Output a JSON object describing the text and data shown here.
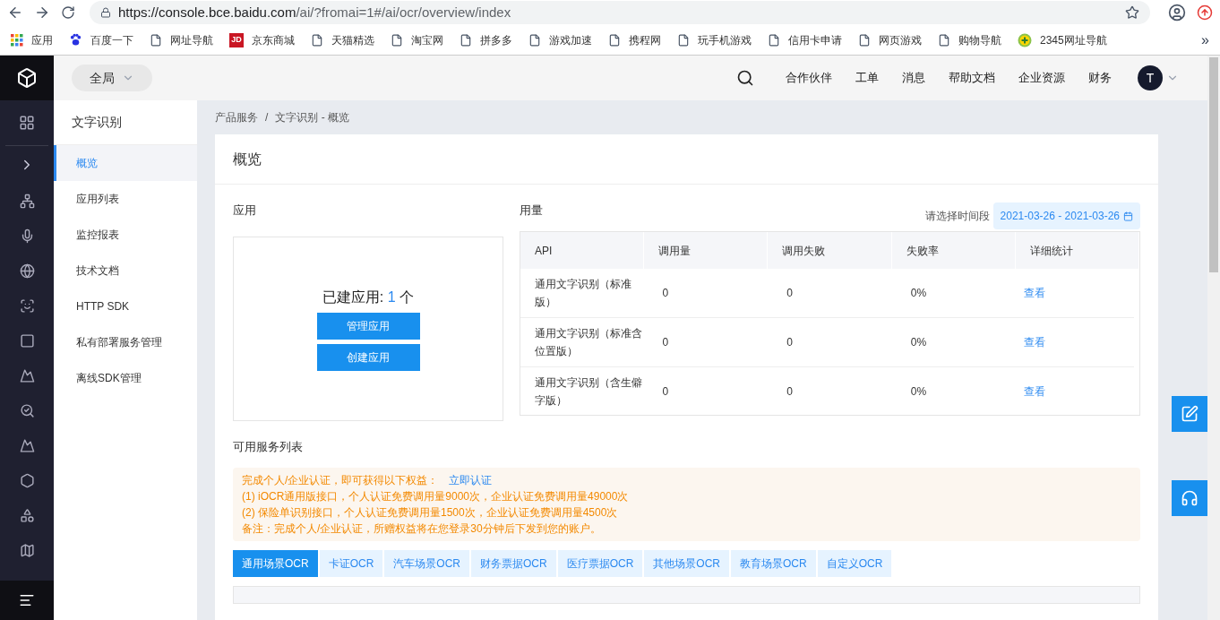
{
  "browser": {
    "url_host": "https://console.bce.baidu.com",
    "url_path": "/ai/?fromai=1#/ai/ocr/overview/index",
    "bookmarks": [
      {
        "kind": "apps",
        "label": "应用"
      },
      {
        "kind": "paw",
        "label": "百度一下"
      },
      {
        "kind": "page",
        "label": "网址导航"
      },
      {
        "kind": "jd",
        "label": "京东商城",
        "logo_text": "JD"
      },
      {
        "kind": "page",
        "label": "天猫精选"
      },
      {
        "kind": "page",
        "label": "淘宝网"
      },
      {
        "kind": "page",
        "label": "拼多多"
      },
      {
        "kind": "page",
        "label": "游戏加速"
      },
      {
        "kind": "page",
        "label": "携程网"
      },
      {
        "kind": "page",
        "label": "玩手机游戏"
      },
      {
        "kind": "page",
        "label": "信用卡申请"
      },
      {
        "kind": "page",
        "label": "网页游戏"
      },
      {
        "kind": "page",
        "label": "购物导航"
      },
      {
        "kind": "plus",
        "label": "2345网址导航"
      }
    ],
    "more": "»"
  },
  "top_bar": {
    "scope": "全局",
    "links": [
      "合作伙伴",
      "工单",
      "消息",
      "帮助文档",
      "企业资源",
      "财务"
    ],
    "avatar": "T"
  },
  "sidebar": {
    "title": "文字识别",
    "items": [
      {
        "label": "概览",
        "selected": true
      },
      {
        "label": "应用列表",
        "selected": false
      },
      {
        "label": "监控报表",
        "selected": false
      },
      {
        "label": "技术文档",
        "selected": false
      },
      {
        "label": "HTTP SDK",
        "selected": false
      },
      {
        "label": "私有部署服务管理",
        "selected": false
      },
      {
        "label": "离线SDK管理",
        "selected": false
      }
    ]
  },
  "breadcrumb": {
    "items": [
      "产品服务",
      "文字识别 - 概览"
    ],
    "separator": "/"
  },
  "page_title": "概览",
  "apps_panel": {
    "title": "应用",
    "count_label": "已建应用:",
    "count": "1",
    "count_unit": "个",
    "buttons": [
      "管理应用",
      "创建应用"
    ]
  },
  "usage": {
    "title": "用量",
    "date_label": "请选择时间段",
    "date_range": "2021-03-26 - 2021-03-26",
    "table": {
      "columns": [
        "API",
        "调用量",
        "调用失败",
        "失败率",
        "详细统计"
      ],
      "rows": [
        {
          "api": "通用文字识别（标准版）",
          "calls": "0",
          "failures": "0",
          "failure_rate": "0%",
          "action": "查看"
        },
        {
          "api": "通用文字识别（标准含位置版）",
          "calls": "0",
          "failures": "0",
          "failure_rate": "0%",
          "action": "查看"
        },
        {
          "api": "通用文字识别（含生僻字版）",
          "calls": "0",
          "failures": "0",
          "failure_rate": "0%",
          "action": "查看"
        }
      ]
    }
  },
  "services": {
    "title": "可用服务列表",
    "notice": {
      "intro": "完成个人/企业认证，即可获得以下权益：",
      "link": "立即认证",
      "lines": [
        "(1) iOCR通用版接口，个人认证免费调用量9000次，企业认证免费调用量49000次",
        "(2) 保险单识别接口，个人认证免费调用量1500次，企业认证免费调用量4500次",
        "备注：完成个人/企业认证，所赠权益将在您登录30分钟后下发到您的账户。"
      ]
    },
    "tabs": [
      {
        "label": "通用场景OCR",
        "selected": true
      },
      {
        "label": "卡证OCR",
        "selected": false
      },
      {
        "label": "汽车场景OCR",
        "selected": false
      },
      {
        "label": "财务票据OCR",
        "selected": false
      },
      {
        "label": "医疗票据OCR",
        "selected": false
      },
      {
        "label": "其他场景OCR",
        "selected": false
      },
      {
        "label": "教育场景OCR",
        "selected": false
      },
      {
        "label": "自定义OCR",
        "selected": false
      }
    ]
  }
}
